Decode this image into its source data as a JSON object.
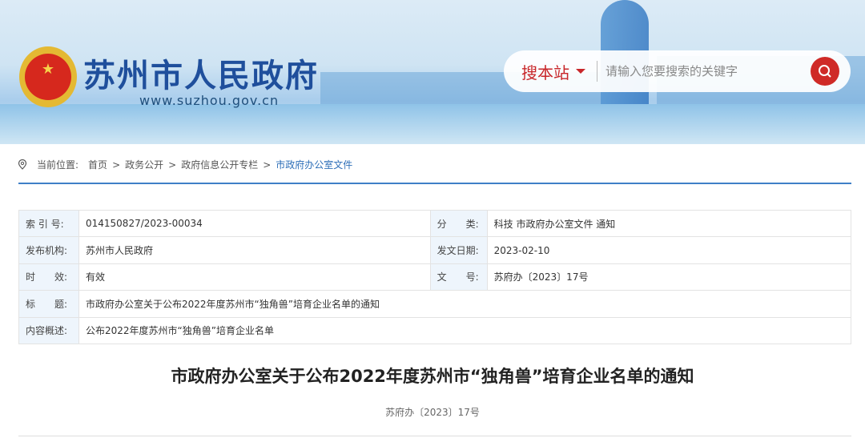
{
  "header": {
    "site_title": "苏州市人民政府",
    "site_url": "www.suzhou.gov.cn",
    "emblem_icon": "national-emblem-icon"
  },
  "search": {
    "scope": "搜本站",
    "placeholder": "请输入您要搜索的关键字",
    "button_icon": "search-icon"
  },
  "breadcrumb": {
    "label": "当前位置:",
    "items": [
      "首页",
      ">",
      "政务公开",
      ">",
      "政府信息公开专栏",
      ">",
      "市政府办公室文件"
    ]
  },
  "meta": {
    "index_label": "索 引 号:",
    "index_value": "014150827/2023-00034",
    "category_label": "分　　类:",
    "category_value": "科技 市政府办公室文件 通知",
    "publisher_label": "发布机构:",
    "publisher_value": "苏州市人民政府",
    "date_label": "发文日期:",
    "date_value": "2023-02-10",
    "validity_label": "时　　效:",
    "validity_value": "有效",
    "docno_label": "文　　号:",
    "docno_value": "苏府办〔2023〕17号",
    "title_label": "标　　题:",
    "title_value": "市政府办公室关于公布2022年度苏州市“独角兽”培育企业名单的通知",
    "summary_label": "内容概述:",
    "summary_value": "公布2022年度苏州市“独角兽”培育企业名单"
  },
  "article": {
    "title": "市政府办公室关于公布2022年度苏州市“独角兽”培育企业名单的通知",
    "doc_number": "苏府办〔2023〕17号"
  },
  "colors": {
    "brand_blue": "#1f4f9c",
    "accent_red": "#cf2a27",
    "link_blue": "#2e6fb8"
  }
}
